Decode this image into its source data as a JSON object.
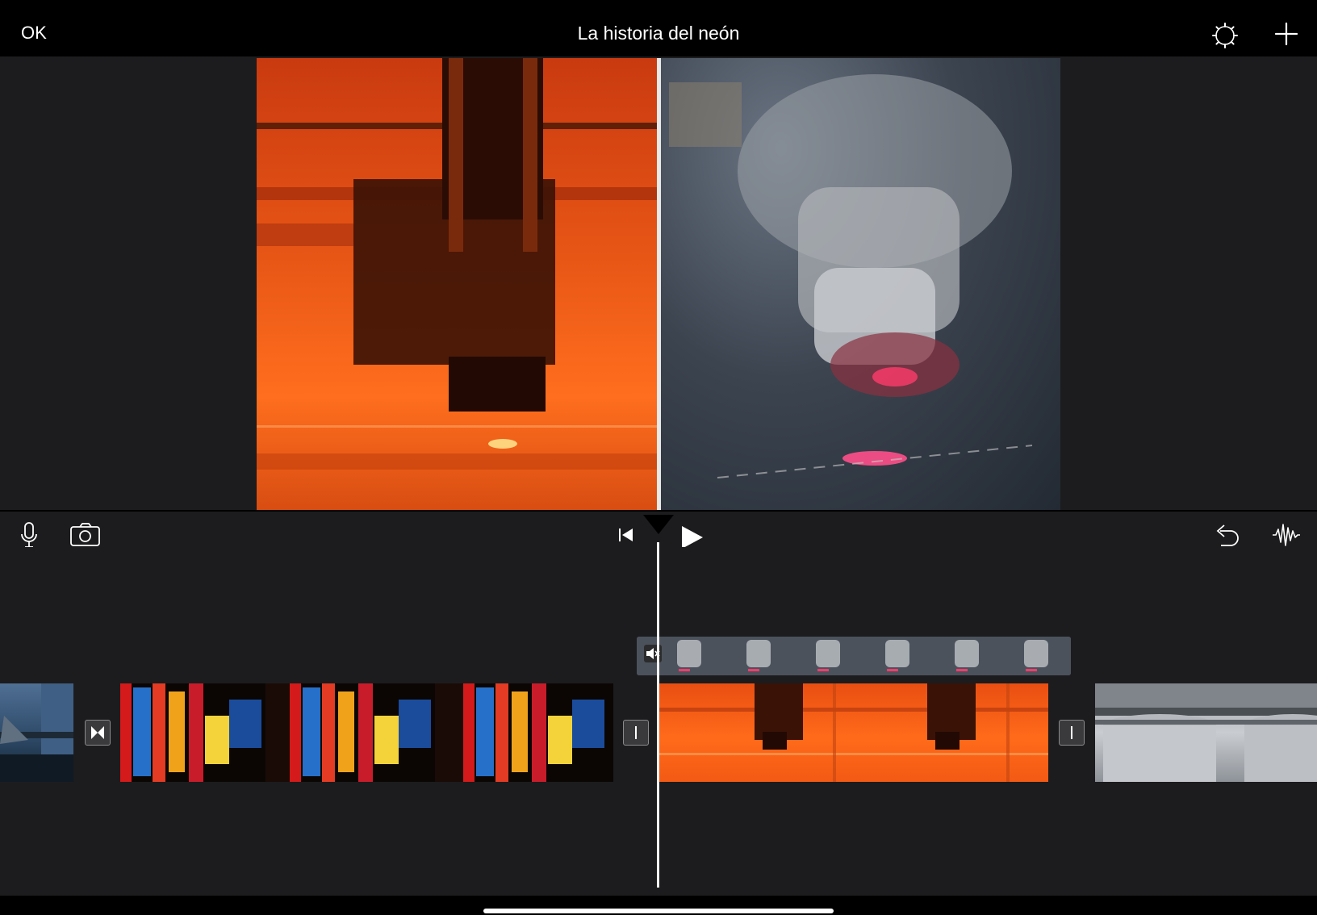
{
  "header": {
    "done_label": "OK",
    "project_title": "La historia del neón"
  },
  "icons": {
    "settings": "gear-icon",
    "add": "plus-icon",
    "microphone": "microphone-icon",
    "camera": "camera-icon",
    "skip_to_start": "skip-back-icon",
    "play": "play-icon",
    "undo": "undo-icon",
    "audio": "waveform-icon",
    "mute": "speaker-muted-icon",
    "transition_cross": "transition-icon",
    "transition_none": "no-transition-icon"
  },
  "colors": {
    "background": "#1c1c1e",
    "bar": "#000000",
    "foreground": "#ffffff",
    "clip_orange": "#ff6a1a"
  }
}
